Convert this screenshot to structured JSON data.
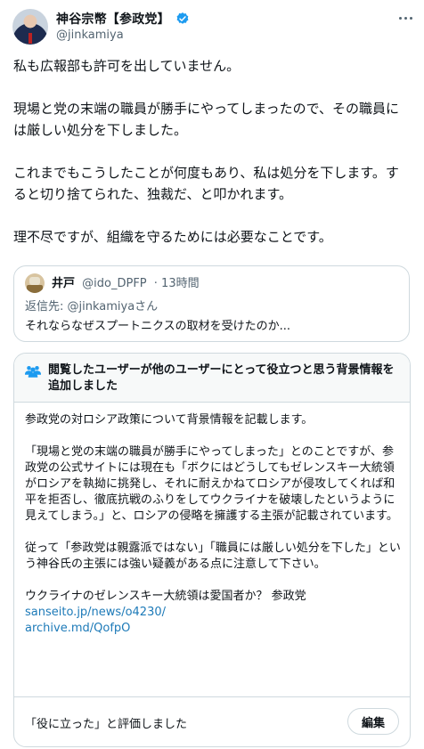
{
  "author": {
    "display_name": "神谷宗幣【参政党】",
    "handle": "@jinkamiya",
    "verified_icon": "verified-badge-icon",
    "verified_color": "#1d9bf0"
  },
  "tweet": {
    "paragraphs": [
      "私も広報部も許可を出していません。",
      "現場と党の末端の職員が勝手にやってしまったので、その職員には厳しい処分を下しました。",
      "これまでもこうしたことが何度もあり、私は処分を下します。すると切り捨てられた、独裁だ、と叩かれます。",
      "理不尽ですが、組織を守るためには必要なことです。"
    ]
  },
  "quote": {
    "name": "井戸",
    "handle": "@ido_DPFP",
    "time": "· 13時間",
    "reply_to": "返信先: @jinkamiyaさん",
    "text": "それならなぜスプートニクスの取材を受けたのか..."
  },
  "community_note": {
    "title": "閲覧したユーザーが他のユーザーにとって役立つと思う背景情報を追加しました",
    "header_icon": "people-icon",
    "paragraphs": [
      "参政党の対ロシア政策について背景情報を記載します。",
      "「現場と党の末端の職員が勝手にやってしまった」とのことですが、参政党の公式サイトには現在も「ボクにはどうしてもゼレンスキー大統領がロシアを執拗に挑発し、それに耐えかねてロシアが侵攻してくれば和平を拒否し、徹底抗戦のふりをしてウクライナを破壊したというように見えてしまう。」と、ロシアの侵略を擁護する主張が記載されています。",
      "従って「参政党は親露派ではない」「職員には厳しい処分を下した」という神谷氏の主張には強い疑義がある点に注意して下さい。",
      "ウクライナのゼレンスキー大統領は愛国者か？ 参政党"
    ],
    "links": [
      "sanseito.jp/news/o4230/",
      "archive.md/QofpO"
    ],
    "link_color": "#1d7ab8",
    "rated_text": "「役に立った」と評価しました",
    "edit_label": "編集"
  }
}
